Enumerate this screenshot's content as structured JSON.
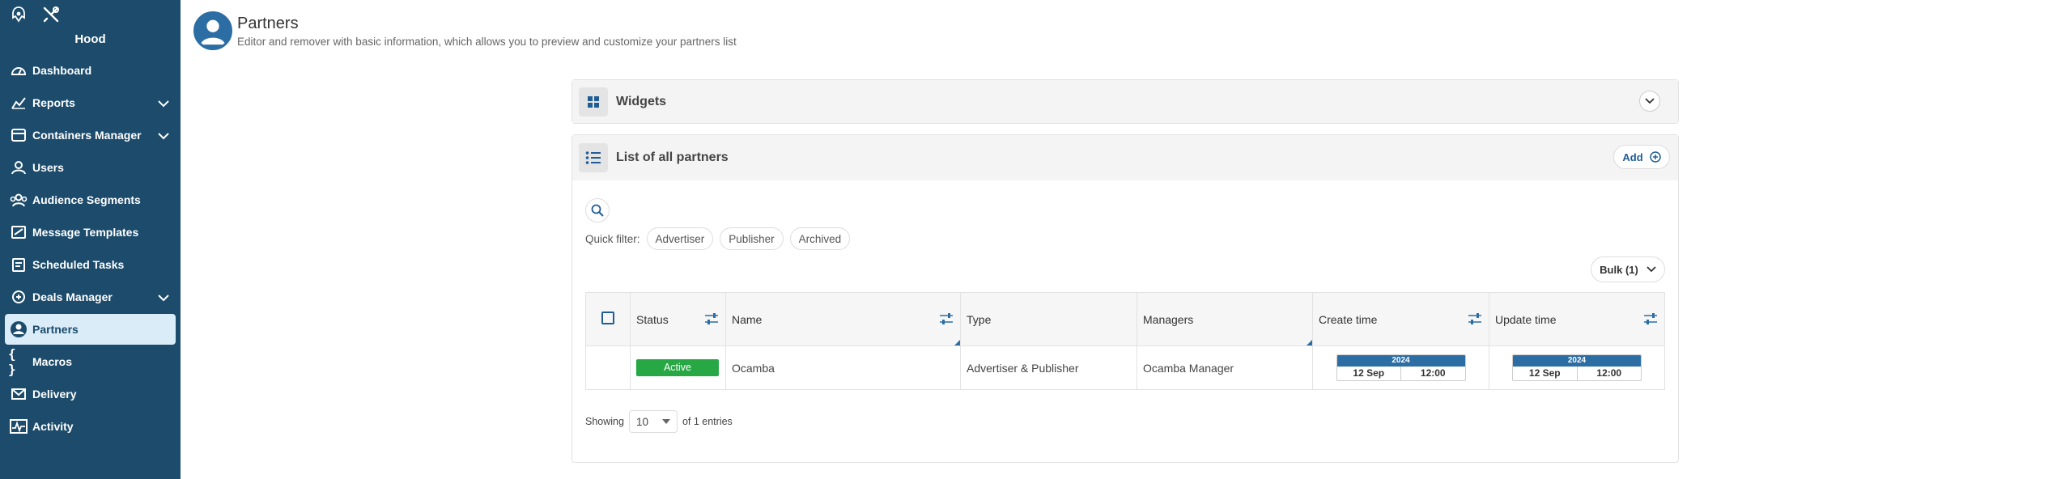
{
  "sidebar": {
    "user": "Hood",
    "items": [
      {
        "label": "Dashboard",
        "icon": "dashboard-icon",
        "has_children": false,
        "active": false
      },
      {
        "label": "Reports",
        "icon": "chart-line-icon",
        "has_children": true,
        "active": false
      },
      {
        "label": "Containers Manager",
        "icon": "containers-icon",
        "has_children": true,
        "active": false
      },
      {
        "label": "Users",
        "icon": "user-icon",
        "has_children": false,
        "active": false
      },
      {
        "label": "Audience Segments",
        "icon": "audience-icon",
        "has_children": false,
        "active": false
      },
      {
        "label": "Message Templates",
        "icon": "message-template-icon",
        "has_children": false,
        "active": false
      },
      {
        "label": "Scheduled Tasks",
        "icon": "scheduled-tasks-icon",
        "has_children": false,
        "active": false
      },
      {
        "label": "Deals Manager",
        "icon": "deals-icon",
        "has_children": true,
        "active": false
      },
      {
        "label": "Partners",
        "icon": "partner-icon",
        "has_children": false,
        "active": true
      },
      {
        "label": "Macros",
        "icon": "braces-icon",
        "has_children": false,
        "active": false
      },
      {
        "label": "Delivery",
        "icon": "delivery-icon",
        "has_children": false,
        "active": false
      },
      {
        "label": "Activity",
        "icon": "activity-icon",
        "has_children": false,
        "active": false
      }
    ]
  },
  "page": {
    "title": "Partners",
    "subtitle": "Editor and remover with basic information, which allows you to preview and customize your partners list"
  },
  "widgets_panel": {
    "title": "Widgets"
  },
  "list_panel": {
    "title": "List of all partners",
    "add_label": "Add",
    "quick_filter_label": "Quick filter:",
    "quick_filters": [
      "Advertiser",
      "Publisher",
      "Archived"
    ],
    "bulk_label": "Bulk (1)",
    "columns": [
      "Status",
      "Name",
      "Type",
      "Managers",
      "Create time",
      "Update time"
    ],
    "rows": [
      {
        "status": "Active",
        "name": "Ocamba",
        "type": "Advertiser & Publisher",
        "managers": "Ocamba Manager",
        "create": {
          "year": "2024",
          "date": "12 Sep",
          "time": "12:00"
        },
        "update": {
          "year": "2024",
          "date": "12 Sep",
          "time": "12:00"
        }
      }
    ],
    "footer": {
      "showing_label": "Showing",
      "page_size": "10",
      "entries_text": "of 1 entries"
    }
  },
  "colors": {
    "sidebar_bg": "#1c4b6b",
    "accent": "#2c6ea4",
    "active_badge": "#27a844"
  }
}
